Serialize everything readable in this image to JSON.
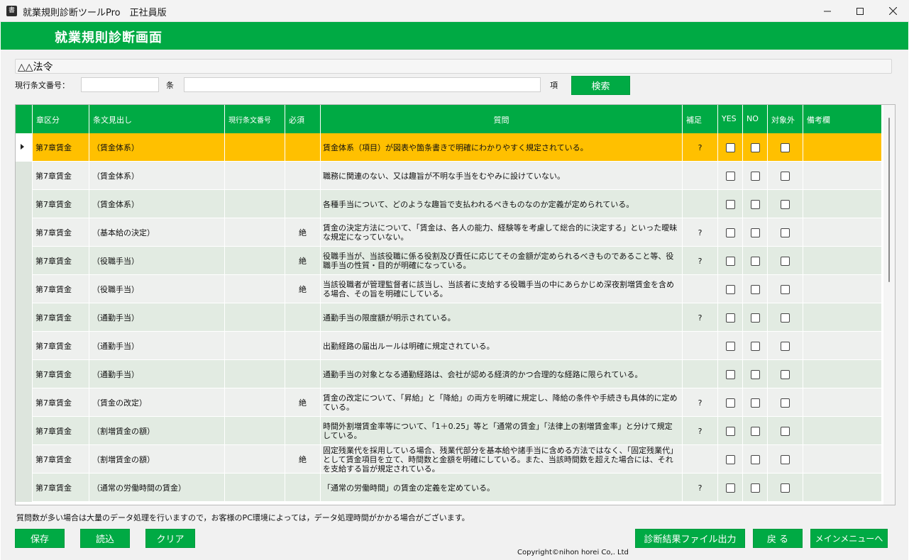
{
  "window": {
    "title": "就業規則診断ツールPro　正社員版",
    "app_icon_glyph": "書"
  },
  "header": {
    "title": "就業規則診断画面"
  },
  "law": {
    "name": "△△法令"
  },
  "search": {
    "article_number_label": "現行条文番号：",
    "article_number_value": "",
    "clause_label": "条",
    "clause_value": "",
    "item_label": "項",
    "search_button": "検索"
  },
  "table": {
    "columns": [
      "章区分",
      "条文見出し",
      "現行条文番号",
      "必須",
      "質問",
      "補足",
      "YES",
      "NO",
      "対象外",
      "備考欄"
    ],
    "rows": [
      {
        "chapter": "第7章賃金",
        "heading": "（賃金体系）",
        "article": "",
        "required": "",
        "question": "賃金体系（項目）が図表や箇条書きで明確にわかりやすく規定されている。",
        "note": "?",
        "remarks": ""
      },
      {
        "chapter": "第7章賃金",
        "heading": "（賃金体系）",
        "article": "",
        "required": "",
        "question": "職務に関連のない、又は趣旨が不明な手当をむやみに設けていない。",
        "note": "",
        "remarks": ""
      },
      {
        "chapter": "第7章賃金",
        "heading": "（賃金体系）",
        "article": "",
        "required": "",
        "question": "各種手当について、どのような趣旨で支払われるべきものなのか定義が定められている。",
        "note": "",
        "remarks": ""
      },
      {
        "chapter": "第7章賃金",
        "heading": "（基本給の決定）",
        "article": "",
        "required": "絶",
        "question": "賃金の決定方法について、「賃金は、各人の能力、経験等を考慮して総合的に決定する」といった曖昧な規定になっていない。",
        "note": "?",
        "remarks": ""
      },
      {
        "chapter": "第7章賃金",
        "heading": "（役職手当）",
        "article": "",
        "required": "絶",
        "question": "役職手当が、当該役職に係る役割及び責任に応じてその金額が定められるべきものであること等、役職手当の性質・目的が明確になっている。",
        "note": "?",
        "remarks": ""
      },
      {
        "chapter": "第7章賃金",
        "heading": "（役職手当）",
        "article": "",
        "required": "絶",
        "question": "当該役職者が管理監督者に該当し、当該者に支給する役職手当の中にあらかじめ深夜割増賃金を含める場合、その旨を明確にしている。",
        "note": "",
        "remarks": ""
      },
      {
        "chapter": "第7章賃金",
        "heading": "（通勤手当）",
        "article": "",
        "required": "",
        "question": "通勤手当の限度額が明示されている。",
        "note": "?",
        "remarks": ""
      },
      {
        "chapter": "第7章賃金",
        "heading": "（通勤手当）",
        "article": "",
        "required": "",
        "question": "出勤経路の届出ルールは明確に規定されている。",
        "note": "",
        "remarks": ""
      },
      {
        "chapter": "第7章賃金",
        "heading": "（通勤手当）",
        "article": "",
        "required": "",
        "question": "通勤手当の対象となる通勤経路は、会社が認める経済的かつ合理的な経路に限られている。",
        "note": "",
        "remarks": ""
      },
      {
        "chapter": "第7章賃金",
        "heading": "（賃金の改定）",
        "article": "",
        "required": "絶",
        "question": "賃金の改定について、「昇給」と「降給」の両方を明確に規定し、降給の条件や手続きも具体的に定めている。",
        "note": "?",
        "remarks": ""
      },
      {
        "chapter": "第7章賃金",
        "heading": "（割増賃金の額）",
        "article": "",
        "required": "",
        "question": "時間外割増賃金率等について、「1＋0.25」等と「通常の賃金」「法律上の割増賃金率」と分けて規定している。",
        "note": "?",
        "remarks": ""
      },
      {
        "chapter": "第7章賃金",
        "heading": "（割増賃金の額）",
        "article": "",
        "required": "絶",
        "question": "固定残業代を採用している場合、残業代部分を基本給や諸手当に含める方法ではなく、「固定残業代」として賃金項目を立て、時間数と金額を明確にしている。また、当該時間数を超えた場合には、それを支給する旨が規定されている。",
        "note": "",
        "remarks": ""
      },
      {
        "chapter": "第7章賃金",
        "heading": "（通常の労働時間の賃金）",
        "article": "",
        "required": "",
        "question": "「通常の労働時間」の賃金の定義を定めている。",
        "note": "?",
        "remarks": ""
      }
    ]
  },
  "notice": "質問数が多い場合は大量のデータ処理を行いますので，お客様のPC環境によっては，データ処理時間がかかる場合がございます。",
  "footer": {
    "save": "保存",
    "load": "読込",
    "clear": "クリア",
    "export": "診断結果ファイル出力",
    "back": "戻 る",
    "main_menu": "メインメニューへ",
    "copyright": "Copyright©nihon horei Co,. Ltd"
  },
  "colors": {
    "brand_green": "#00aa44",
    "selected_row": "#ffc000",
    "row_light": "#eef0ee",
    "row_alt": "#e2ebe2"
  }
}
